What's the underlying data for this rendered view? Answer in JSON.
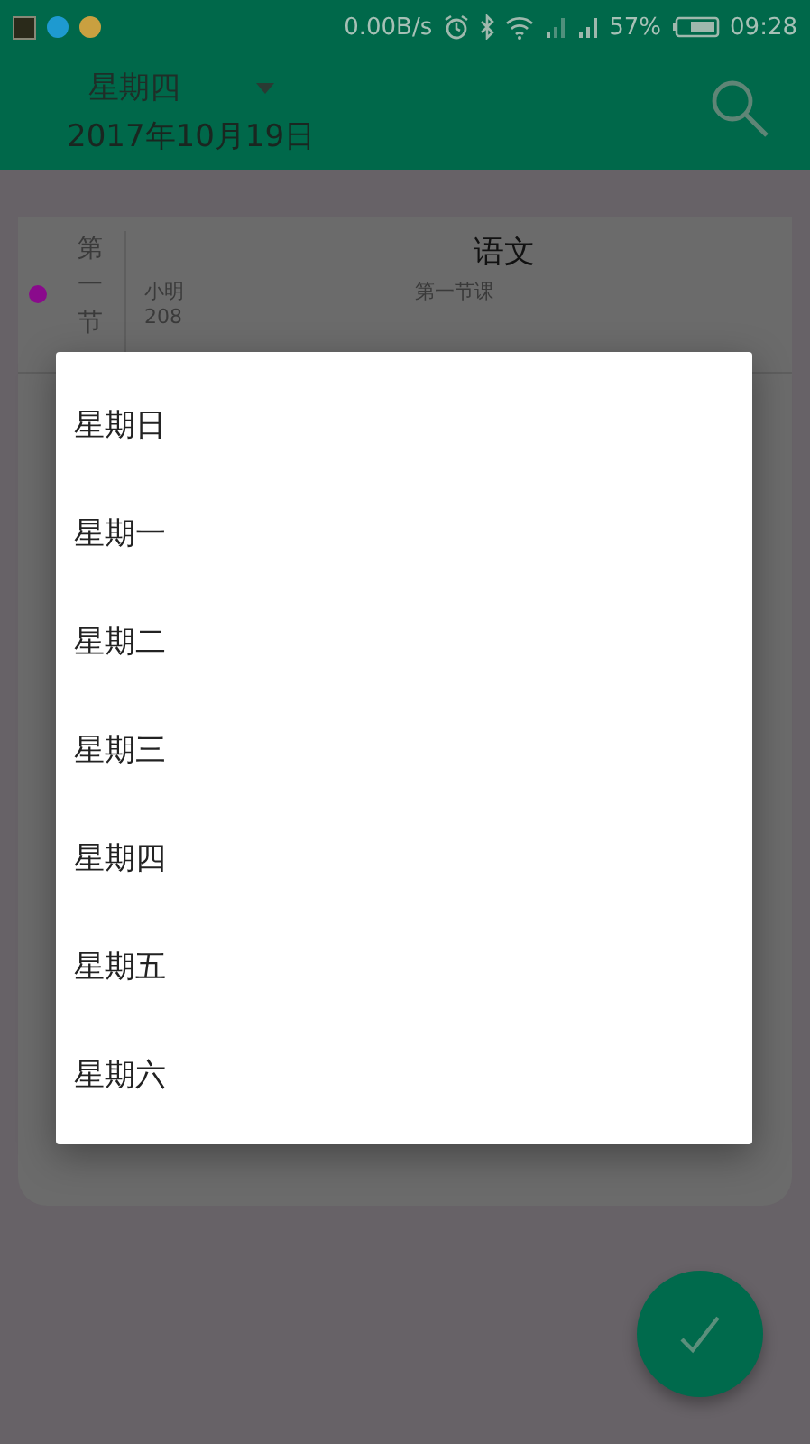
{
  "status_bar": {
    "speed": "0.00B/s",
    "battery": "57%",
    "time": "09:28"
  },
  "toolbar": {
    "weekday": "星期四",
    "date": "2017年10月19日"
  },
  "lesson": {
    "period": "第一节",
    "color": "#8a0a8c",
    "subject": "语文",
    "teacher": "小明",
    "room": "208",
    "note": "第一节课"
  },
  "dialog": {
    "options": [
      {
        "label": "星期日"
      },
      {
        "label": "星期一"
      },
      {
        "label": "星期二"
      },
      {
        "label": "星期三"
      },
      {
        "label": "星期四"
      },
      {
        "label": "星期五"
      },
      {
        "label": "星期六"
      }
    ]
  }
}
